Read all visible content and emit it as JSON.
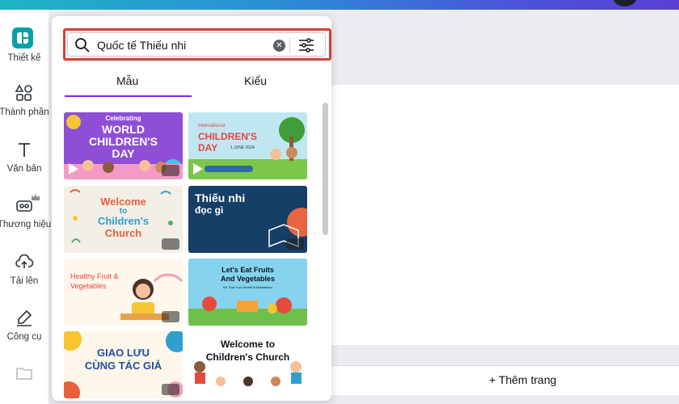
{
  "sidebar": {
    "items": [
      {
        "label": "Thiết kế",
        "icon": "canva-logo-icon"
      },
      {
        "label": "Thành phần",
        "icon": "shapes-icon"
      },
      {
        "label": "Văn bản",
        "icon": "text-icon"
      },
      {
        "label": "Thương hiệu",
        "icon": "brand-icon"
      },
      {
        "label": "Tải lên",
        "icon": "upload-icon"
      },
      {
        "label": "Công cụ",
        "icon": "draw-icon"
      }
    ]
  },
  "panel": {
    "search": {
      "value": "Quốc tế Thiếu nhi",
      "clear": "✕"
    },
    "tabs": [
      {
        "label": "Mẫu",
        "active": true
      },
      {
        "label": "Kiểu",
        "active": false
      }
    ],
    "templates": [
      {
        "lines": [
          "Celebrating",
          "WORLD",
          "CHILDREN'S",
          "DAY"
        ],
        "bg": "#8e4fd6",
        "has_play": true
      },
      {
        "lines": [
          "International",
          "CHILDREN'S",
          "DAY",
          "1 JUNE 2024"
        ],
        "bg": "#bfe7f2",
        "has_play": true
      },
      {
        "lines": [
          "Welcome",
          "to",
          "Children's",
          "Church"
        ],
        "bg": "#f4efe6",
        "has_play": false
      },
      {
        "lines": [
          "Thiếu nhi",
          "đọc gì"
        ],
        "bg": "#153f66",
        "has_play": false
      },
      {
        "lines": [
          "Healthy Fruit &",
          "Vegetables"
        ],
        "bg": "#fff7ec",
        "has_play": false
      },
      {
        "lines": [
          "Let's Eat Fruits",
          "And Vegetables",
          "Be That Your Health is Maintained"
        ],
        "bg": "#86d3ef",
        "has_play": false
      },
      {
        "lines": [
          "GIAO LƯU",
          "CÙNG TÁC GIẢ"
        ],
        "bg": "#fdf6ea",
        "has_play": false
      },
      {
        "lines": [
          "Welcome to",
          "Children's Church"
        ],
        "bg": "#ffffff",
        "has_play": false
      }
    ]
  },
  "canvas": {
    "add_page_label": "+ Thêm trang"
  },
  "colors": {
    "accent": "#7d2ae8",
    "highlight_border": "#d2402f",
    "brand_teal": "#0a9fa8"
  }
}
